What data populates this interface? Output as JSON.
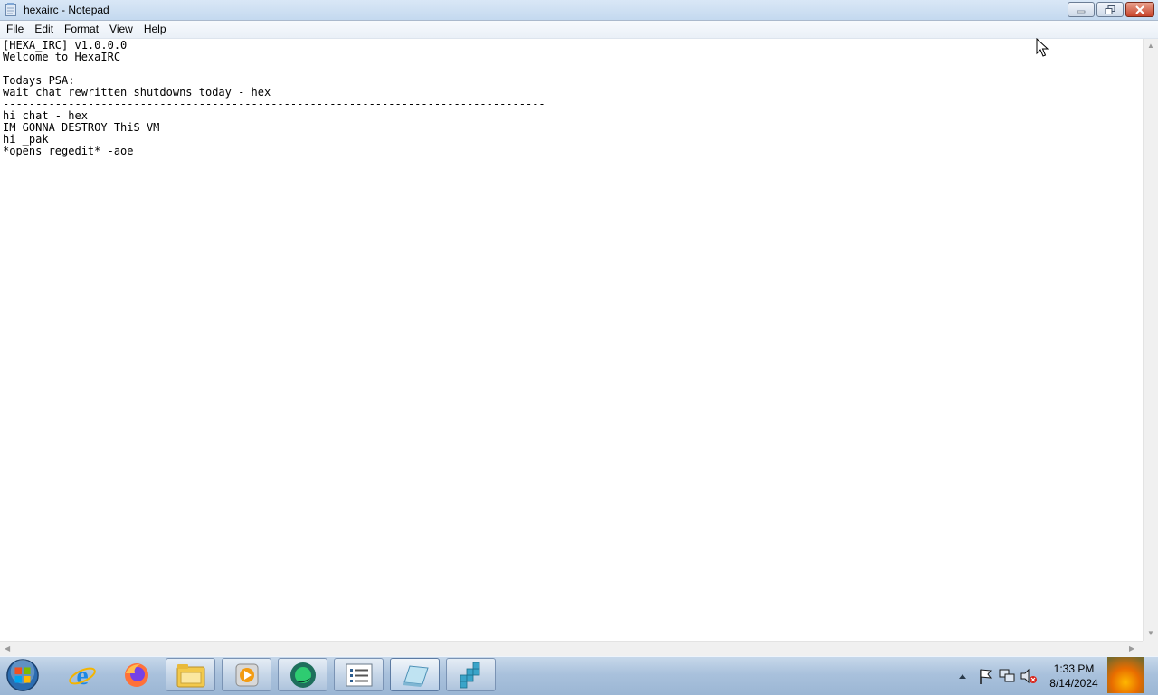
{
  "window": {
    "title": "hexairc - Notepad"
  },
  "menu": [
    "File",
    "Edit",
    "Format",
    "View",
    "Help"
  ],
  "editor": {
    "lines": [
      "[HEXA_IRC] v1.0.0.0",
      "Welcome to HexaIRC",
      "",
      "Todays PSA:",
      "wait chat rewritten shutdowns today - hex",
      "-----------------------------------------------------------------------------------",
      "hi chat - hex",
      "IM GONNA DESTROY ThiS VM",
      "hi _pak",
      "*opens regedit* -aoe"
    ]
  },
  "taskbar": {
    "items": [
      {
        "icon": "internet-explorer-icon",
        "state": "pinned"
      },
      {
        "icon": "firefox-icon",
        "state": "pinned"
      },
      {
        "icon": "file-explorer-icon",
        "state": "open"
      },
      {
        "icon": "media-player-icon",
        "state": "open"
      },
      {
        "icon": "chat-client-icon",
        "state": "open"
      },
      {
        "icon": "list-app-icon",
        "state": "open"
      },
      {
        "icon": "notepad-icon",
        "state": "active"
      },
      {
        "icon": "registry-editor-icon",
        "state": "open"
      }
    ],
    "tray": [
      "show-hidden-icons-icon",
      "action-center-flag-icon",
      "network-icon",
      "volume-muted-icon"
    ]
  },
  "clock": {
    "time": "1:33 PM",
    "date": "8/14/2024"
  },
  "colors": {
    "titlebar": "#c4d9ef",
    "close_button": "#c8452b",
    "taskbar": "#a9c1dc"
  }
}
